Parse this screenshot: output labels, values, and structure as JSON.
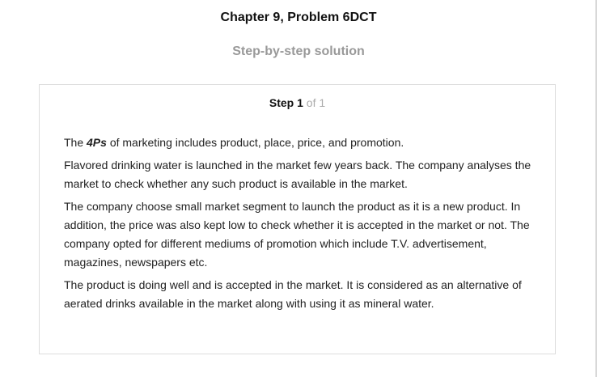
{
  "header": {
    "title": "Chapter 9, Problem 6DCT",
    "subtitle": "Step-by-step solution"
  },
  "step": {
    "label": "Step",
    "number": "1",
    "of_text": "of 1"
  },
  "paragraphs": {
    "p1_before": "The ",
    "p1_term": "4Ps",
    "p1_after": " of marketing includes product, place, price, and promotion.",
    "p2": "Flavored drinking water is launched in the market few years back. The company analyses the market to check whether any such product is available in the market.",
    "p3": "The company choose small market segment to launch the product as it is a new product. In addition, the price was also kept low to check whether it is accepted in the market or not. The company opted for different mediums of promotion which include T.V. advertisement, magazines, newspapers etc.",
    "p4": "The product is doing well and is accepted in the market. It is considered as an alternative of aerated drinks available in the market along with using it as mineral water."
  }
}
